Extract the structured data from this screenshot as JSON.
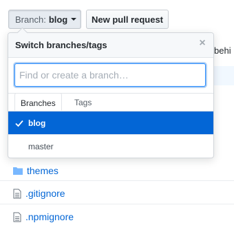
{
  "toolbar": {
    "branch_prefix": "Branch:",
    "branch_name": "blog",
    "new_pr_label": "New pull request"
  },
  "background": {
    "peek_text": "behi"
  },
  "dropdown": {
    "title": "Switch branches/tags",
    "close_glyph": "×",
    "filter_placeholder": "Find or create a branch…",
    "tabs": [
      "Branches",
      "Tags"
    ],
    "branches": [
      {
        "name": "blog",
        "selected": true
      },
      {
        "name": "master",
        "selected": false
      }
    ]
  },
  "files": [
    {
      "name": "themes",
      "type": "folder",
      "icon": "folder-icon"
    },
    {
      "name": ".gitignore",
      "type": "file",
      "icon": "file-icon"
    },
    {
      "name": ".npmignore",
      "type": "file",
      "icon": "file-icon"
    }
  ],
  "colors": {
    "accent": "#0366d6",
    "focus_border": "#2188ff",
    "link": "#0366d6",
    "icon_gray": "#6a737d",
    "folder_blue": "#79b8ff"
  }
}
